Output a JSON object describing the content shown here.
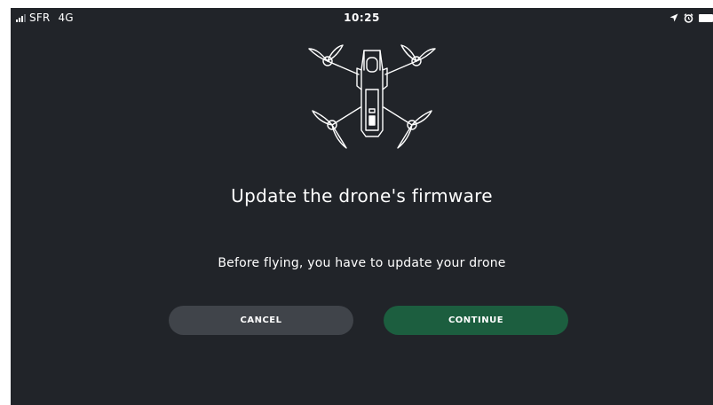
{
  "status_bar": {
    "carrier": "SFR",
    "network": "4G",
    "time": "10:25",
    "icons": [
      "signal-icon",
      "location-arrow-icon",
      "alarm-icon",
      "battery-icon"
    ]
  },
  "illustration": {
    "icon": "drone-icon"
  },
  "dialog": {
    "title": "Update the drone's firmware",
    "message": "Before flying, you have to update your drone",
    "cancel_label": "CANCEL",
    "continue_label": "CONTINUE"
  },
  "colors": {
    "background": "#212429",
    "cancel_button": "#40444a",
    "continue_button": "#1c5e3f",
    "text": "#ffffff"
  }
}
